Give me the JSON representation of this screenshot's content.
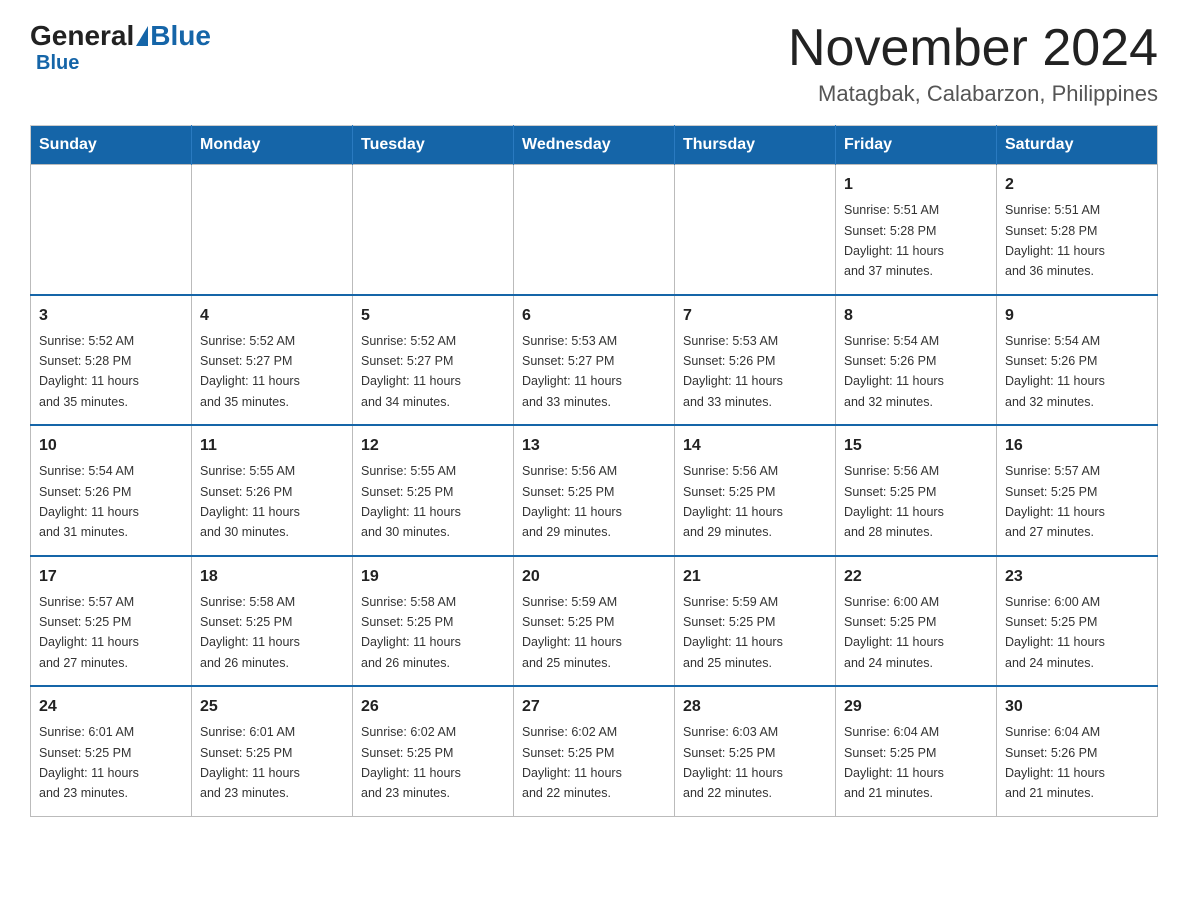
{
  "logo": {
    "general": "General",
    "blue": "Blue"
  },
  "title": "November 2024",
  "subtitle": "Matagbak, Calabarzon, Philippines",
  "weekdays": [
    "Sunday",
    "Monday",
    "Tuesday",
    "Wednesday",
    "Thursday",
    "Friday",
    "Saturday"
  ],
  "weeks": [
    [
      {
        "day": "",
        "info": ""
      },
      {
        "day": "",
        "info": ""
      },
      {
        "day": "",
        "info": ""
      },
      {
        "day": "",
        "info": ""
      },
      {
        "day": "",
        "info": ""
      },
      {
        "day": "1",
        "info": "Sunrise: 5:51 AM\nSunset: 5:28 PM\nDaylight: 11 hours\nand 37 minutes."
      },
      {
        "day": "2",
        "info": "Sunrise: 5:51 AM\nSunset: 5:28 PM\nDaylight: 11 hours\nand 36 minutes."
      }
    ],
    [
      {
        "day": "3",
        "info": "Sunrise: 5:52 AM\nSunset: 5:28 PM\nDaylight: 11 hours\nand 35 minutes."
      },
      {
        "day": "4",
        "info": "Sunrise: 5:52 AM\nSunset: 5:27 PM\nDaylight: 11 hours\nand 35 minutes."
      },
      {
        "day": "5",
        "info": "Sunrise: 5:52 AM\nSunset: 5:27 PM\nDaylight: 11 hours\nand 34 minutes."
      },
      {
        "day": "6",
        "info": "Sunrise: 5:53 AM\nSunset: 5:27 PM\nDaylight: 11 hours\nand 33 minutes."
      },
      {
        "day": "7",
        "info": "Sunrise: 5:53 AM\nSunset: 5:26 PM\nDaylight: 11 hours\nand 33 minutes."
      },
      {
        "day": "8",
        "info": "Sunrise: 5:54 AM\nSunset: 5:26 PM\nDaylight: 11 hours\nand 32 minutes."
      },
      {
        "day": "9",
        "info": "Sunrise: 5:54 AM\nSunset: 5:26 PM\nDaylight: 11 hours\nand 32 minutes."
      }
    ],
    [
      {
        "day": "10",
        "info": "Sunrise: 5:54 AM\nSunset: 5:26 PM\nDaylight: 11 hours\nand 31 minutes."
      },
      {
        "day": "11",
        "info": "Sunrise: 5:55 AM\nSunset: 5:26 PM\nDaylight: 11 hours\nand 30 minutes."
      },
      {
        "day": "12",
        "info": "Sunrise: 5:55 AM\nSunset: 5:25 PM\nDaylight: 11 hours\nand 30 minutes."
      },
      {
        "day": "13",
        "info": "Sunrise: 5:56 AM\nSunset: 5:25 PM\nDaylight: 11 hours\nand 29 minutes."
      },
      {
        "day": "14",
        "info": "Sunrise: 5:56 AM\nSunset: 5:25 PM\nDaylight: 11 hours\nand 29 minutes."
      },
      {
        "day": "15",
        "info": "Sunrise: 5:56 AM\nSunset: 5:25 PM\nDaylight: 11 hours\nand 28 minutes."
      },
      {
        "day": "16",
        "info": "Sunrise: 5:57 AM\nSunset: 5:25 PM\nDaylight: 11 hours\nand 27 minutes."
      }
    ],
    [
      {
        "day": "17",
        "info": "Sunrise: 5:57 AM\nSunset: 5:25 PM\nDaylight: 11 hours\nand 27 minutes."
      },
      {
        "day": "18",
        "info": "Sunrise: 5:58 AM\nSunset: 5:25 PM\nDaylight: 11 hours\nand 26 minutes."
      },
      {
        "day": "19",
        "info": "Sunrise: 5:58 AM\nSunset: 5:25 PM\nDaylight: 11 hours\nand 26 minutes."
      },
      {
        "day": "20",
        "info": "Sunrise: 5:59 AM\nSunset: 5:25 PM\nDaylight: 11 hours\nand 25 minutes."
      },
      {
        "day": "21",
        "info": "Sunrise: 5:59 AM\nSunset: 5:25 PM\nDaylight: 11 hours\nand 25 minutes."
      },
      {
        "day": "22",
        "info": "Sunrise: 6:00 AM\nSunset: 5:25 PM\nDaylight: 11 hours\nand 24 minutes."
      },
      {
        "day": "23",
        "info": "Sunrise: 6:00 AM\nSunset: 5:25 PM\nDaylight: 11 hours\nand 24 minutes."
      }
    ],
    [
      {
        "day": "24",
        "info": "Sunrise: 6:01 AM\nSunset: 5:25 PM\nDaylight: 11 hours\nand 23 minutes."
      },
      {
        "day": "25",
        "info": "Sunrise: 6:01 AM\nSunset: 5:25 PM\nDaylight: 11 hours\nand 23 minutes."
      },
      {
        "day": "26",
        "info": "Sunrise: 6:02 AM\nSunset: 5:25 PM\nDaylight: 11 hours\nand 23 minutes."
      },
      {
        "day": "27",
        "info": "Sunrise: 6:02 AM\nSunset: 5:25 PM\nDaylight: 11 hours\nand 22 minutes."
      },
      {
        "day": "28",
        "info": "Sunrise: 6:03 AM\nSunset: 5:25 PM\nDaylight: 11 hours\nand 22 minutes."
      },
      {
        "day": "29",
        "info": "Sunrise: 6:04 AM\nSunset: 5:25 PM\nDaylight: 11 hours\nand 21 minutes."
      },
      {
        "day": "30",
        "info": "Sunrise: 6:04 AM\nSunset: 5:26 PM\nDaylight: 11 hours\nand 21 minutes."
      }
    ]
  ]
}
